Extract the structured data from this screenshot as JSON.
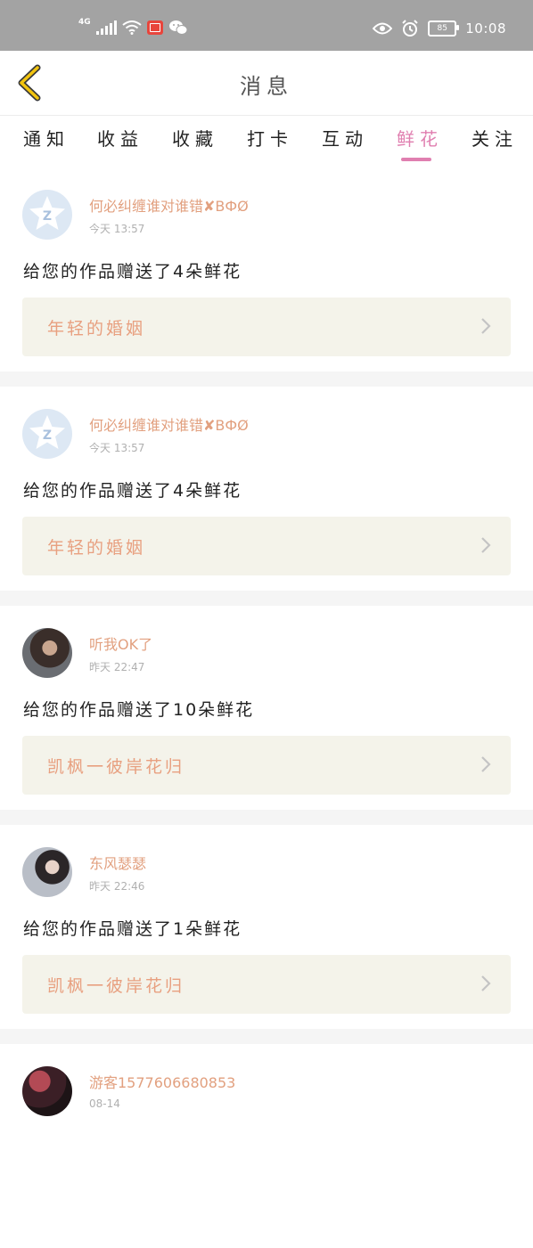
{
  "status_bar": {
    "network": "4G",
    "time": "10:08",
    "battery": "85"
  },
  "header": {
    "title": "消息"
  },
  "tabs": [
    {
      "label": "通知",
      "active": false
    },
    {
      "label": "收益",
      "active": false
    },
    {
      "label": "收藏",
      "active": false
    },
    {
      "label": "打卡",
      "active": false
    },
    {
      "label": "互动",
      "active": false
    },
    {
      "label": "鲜花",
      "active": true
    },
    {
      "label": "关注",
      "active": false
    }
  ],
  "colors": {
    "accent": "#e07fb0",
    "name": "#e2a07f",
    "work_bg": "#f4f3ea"
  },
  "messages": [
    {
      "avatar": "default-avatar-icon",
      "name": "何必纠缠谁对谁错✘ВФØ",
      "time": "今天 13:57",
      "text": "给您的作品赠送了4朵鲜花",
      "work": "年轻的婚姻"
    },
    {
      "avatar": "default-avatar-icon",
      "name": "何必纠缠谁对谁错✘ВФØ",
      "time": "今天 13:57",
      "text": "给您的作品赠送了4朵鲜花",
      "work": "年轻的婚姻"
    },
    {
      "avatar": "photo",
      "name": "听我OK了",
      "time": "昨天 22:47",
      "text": "给您的作品赠送了10朵鲜花",
      "work": "凯枫一彼岸花归"
    },
    {
      "avatar": "photo",
      "name": "东风瑟瑟",
      "time": "昨天 22:46",
      "text": "给您的作品赠送了1朵鲜花",
      "work": "凯枫一彼岸花归"
    },
    {
      "avatar": "photo",
      "name": "游客1577606680853",
      "time": "08-14"
    }
  ]
}
